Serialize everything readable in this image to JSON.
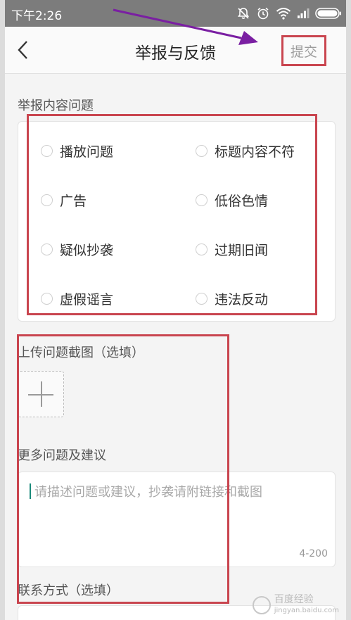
{
  "status_bar": {
    "time": "下午2:26",
    "icons": [
      "mute-icon",
      "alarm-icon",
      "wifi-icon",
      "signal-icon",
      "battery-icon"
    ]
  },
  "nav": {
    "back_icon": "chevron-left-icon",
    "title": "举报与反馈",
    "submit_label": "提交"
  },
  "report_section": {
    "title": "举报内容问题",
    "options": [
      "播放问题",
      "标题内容不符",
      "广告",
      "低俗色情",
      "疑似抄袭",
      "过期旧闻",
      "虚假谣言",
      "违法反动"
    ]
  },
  "upload_section": {
    "title": "上传问题截图（选填）",
    "add_icon": "plus-icon"
  },
  "suggestion_section": {
    "title": "更多问题及建议",
    "placeholder": "请描述问题或建议，抄袭请附链接和截图",
    "counter": "4-200"
  },
  "contact_section": {
    "title": "联系方式（选填）"
  },
  "watermark": {
    "name": "百度经验",
    "url": "jingyan.baidu.com"
  },
  "colors": {
    "highlight": "#c9454f",
    "annotation_arrow": "#7a1fa2",
    "status_bar": "#7c7c7c"
  }
}
